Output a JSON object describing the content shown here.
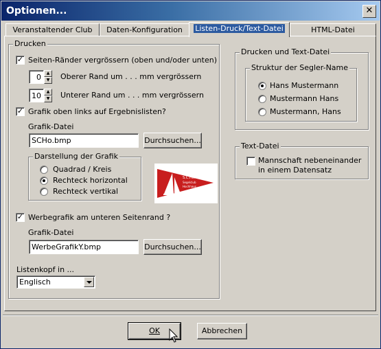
{
  "window": {
    "title": "Optionen...",
    "close_glyph": "✕"
  },
  "tabs": [
    {
      "label": "Veranstaltender Club"
    },
    {
      "label": "Daten-Konfiguration"
    },
    {
      "label": "Listen-Druck/Text-Datei"
    },
    {
      "label": "HTML-Datei"
    }
  ],
  "drucken": {
    "legend": "Drucken",
    "margins_checkbox": {
      "label": "Seiten-Ränder vergrössern  (oben und/oder unten)",
      "checked": "✓"
    },
    "top_margin": {
      "value": "0",
      "label": "Oberer Rand um . . .  mm  vergrössern"
    },
    "bottom_margin": {
      "value": "10",
      "label": "Unterer Rand um . . .  mm  vergrössern"
    },
    "graphic_checkbox": {
      "label": "Grafik oben links auf Ergebnislisten?",
      "checked": "✓"
    },
    "graphic_file_label": "Grafik-Datei",
    "graphic_file_value": "SCHo.bmp",
    "browse_label": "Durchsuchen...",
    "display_group": {
      "legend": "Darstellung der Grafik",
      "options": [
        "Quadrad / Kreis",
        "Rechteck horizontal",
        "Rechteck vertikal"
      ],
      "selected": "Rechteck horizontal"
    },
    "logo": {
      "line1": "S.C.Ho.",
      "line2": "Segelclub",
      "line3": "Hochhaus"
    },
    "ad_checkbox": {
      "label": "Werbegrafik am unteren Seitenrand ?",
      "checked": "✓"
    },
    "ad_file_label": "Grafik-Datei",
    "ad_file_value": "WerbeGrafikY.bmp",
    "ad_browse_label": "Durchsuchen...",
    "header_label": "Listenkopf in ...",
    "header_value": "Englisch"
  },
  "druck_text": {
    "legend": "Drucken und Text-Datei",
    "structure_legend": "Struktur der Segler-Name",
    "options": [
      "Hans Mustermann",
      "Mustermann Hans",
      "Mustermann, Hans"
    ],
    "selected": "Hans Mustermann"
  },
  "text_datei": {
    "legend": "Text-Datei",
    "checkbox_label_1": "Mannschaft nebeneinander",
    "checkbox_label_2": "in einem Datensatz"
  },
  "footer": {
    "ok_label": "OK",
    "cancel_label": "Abbrechen"
  }
}
